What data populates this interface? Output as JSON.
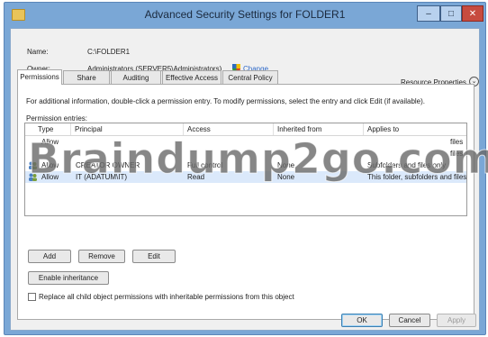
{
  "window": {
    "title": "Advanced Security Settings for FOLDER1",
    "min_glyph": "–",
    "max_glyph": "□",
    "close_glyph": "✕"
  },
  "info": {
    "name_label": "Name:",
    "name_value": "C:\\FOLDER1",
    "owner_label": "Owner:",
    "owner_value": "Administrators (SERVER5\\Administrators)",
    "change_link": "Change",
    "resource_properties": "Resource Properties",
    "expand_glyph": "⌄"
  },
  "tabs": [
    {
      "label": "Permissions",
      "active": true
    },
    {
      "label": "Share",
      "active": false
    },
    {
      "label": "Auditing",
      "active": false
    },
    {
      "label": "Effective Access",
      "active": false
    },
    {
      "label": "Central Policy",
      "active": false
    }
  ],
  "permissions": {
    "help_text": "For additional information, double-click a permission entry. To modify permissions, select the entry and click Edit (if available).",
    "entries_label": "Permission entries:",
    "columns": [
      "Type",
      "Principal",
      "Access",
      "Inherited from",
      "Applies to"
    ],
    "rows": [
      {
        "type": "Allow",
        "principal": "",
        "access": "",
        "inherited": "",
        "applies": "files",
        "selected": false
      },
      {
        "type": "",
        "principal": "",
        "access": "",
        "inherited": "",
        "applies": "files",
        "selected": false
      },
      {
        "type": "Allow",
        "principal": "CREATOR OWNER",
        "access": "Full control",
        "inherited": "None",
        "applies": "Subfolders and files only",
        "selected": false
      },
      {
        "type": "Allow",
        "principal": "IT (ADATUM\\IT)",
        "access": "Read",
        "inherited": "None",
        "applies": "This folder, subfolders and files",
        "selected": true
      }
    ]
  },
  "buttons": {
    "add": "Add",
    "remove": "Remove",
    "edit": "Edit",
    "enable_inheritance": "Enable inheritance",
    "ok": "OK",
    "cancel": "Cancel",
    "apply": "Apply"
  },
  "replace_checkbox_label": "Replace all child object permissions with inheritable permissions from this object",
  "watermark": "Braindump2go.com",
  "colors": {
    "title_bg": "#7aa7d6",
    "close_red": "#c74b3f",
    "link_blue": "#2a66c7",
    "selection": "#dbe9fb"
  }
}
